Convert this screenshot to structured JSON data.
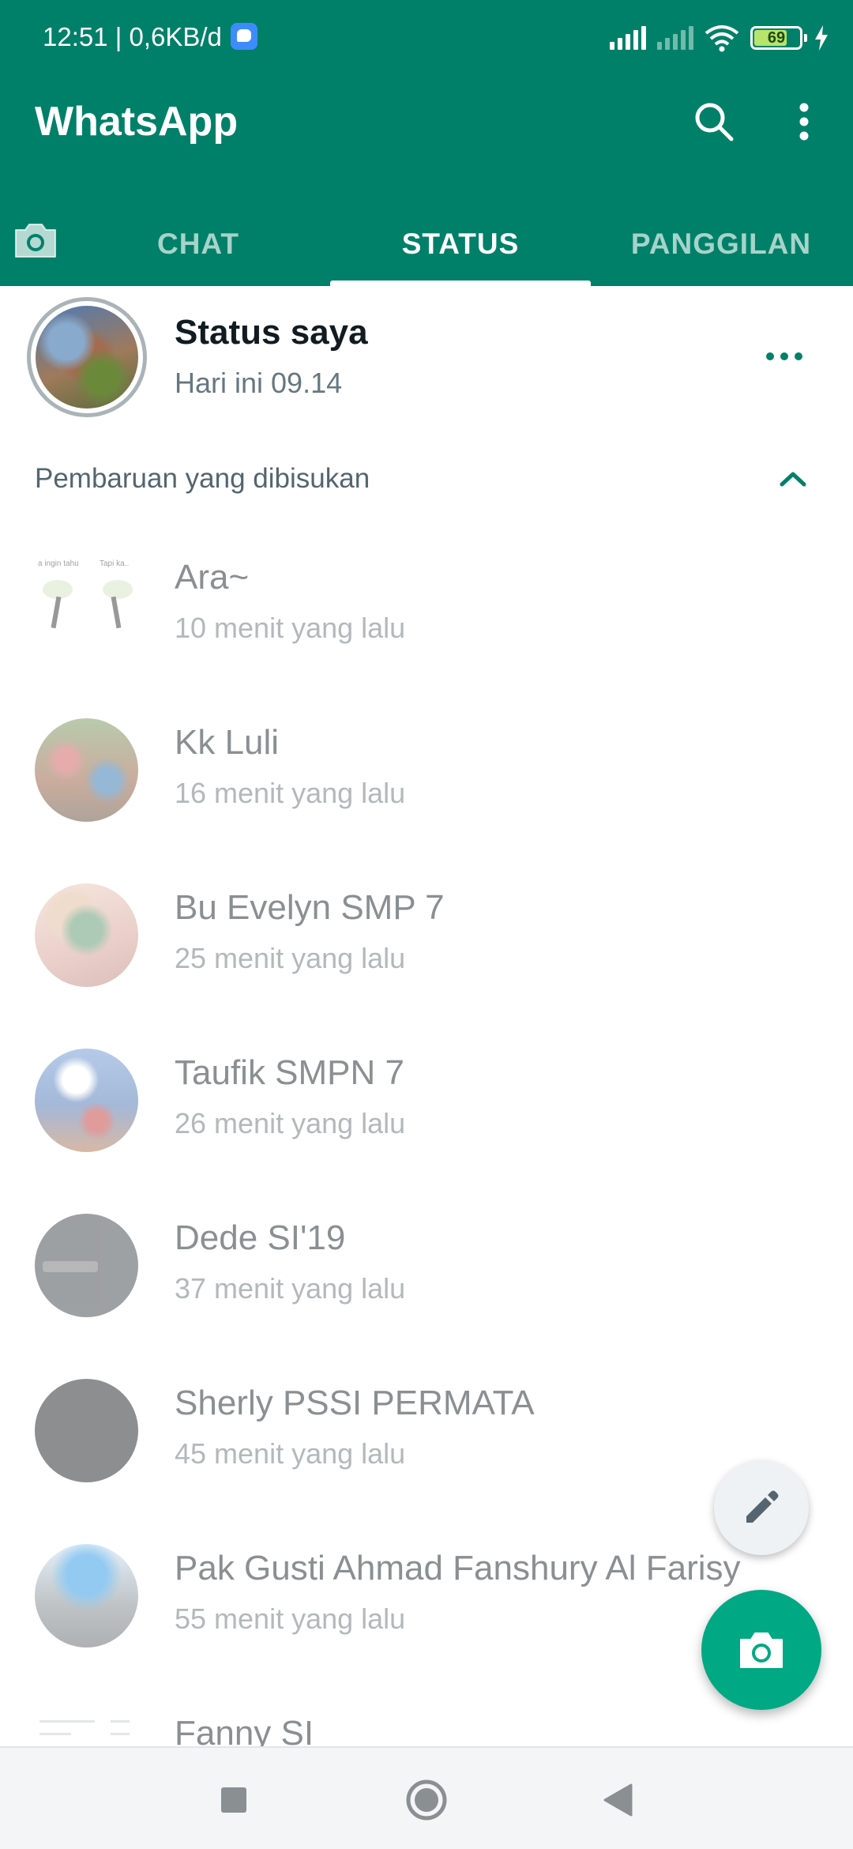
{
  "status_bar": {
    "time": "12:51 | 0,6KB/d",
    "battery_level": "69"
  },
  "header": {
    "title": "WhatsApp",
    "tabs": [
      {
        "label": "CHAT",
        "active": false
      },
      {
        "label": "STATUS",
        "active": true
      },
      {
        "label": "PANGGILAN",
        "active": false
      }
    ]
  },
  "my_status": {
    "name": "Status saya",
    "time": "Hari ini 09.14"
  },
  "muted_section": {
    "title": "Pembaruan yang dibisukan",
    "contacts": [
      {
        "name": "Ara~",
        "time": "10 menit yang lalu"
      },
      {
        "name": "Kk Luli",
        "time": "16 menit yang lalu"
      },
      {
        "name": "Bu Evelyn SMP 7",
        "time": "25 menit yang lalu"
      },
      {
        "name": "Taufik SMPN 7",
        "time": "26 menit yang lalu"
      },
      {
        "name": "Dede SI'19",
        "time": "37 menit yang lalu"
      },
      {
        "name": "Sherly PSSI PERMATA",
        "time": "45 menit yang lalu"
      },
      {
        "name": "Pak Gusti Ahmad Fanshury Al Farisy",
        "time": "55 menit yang lalu"
      },
      {
        "name": "Fanny SI",
        "time": ""
      }
    ]
  },
  "colors": {
    "brand_green": "#008069",
    "fab_green": "#00a884",
    "muted_text": "#8a8f92"
  }
}
